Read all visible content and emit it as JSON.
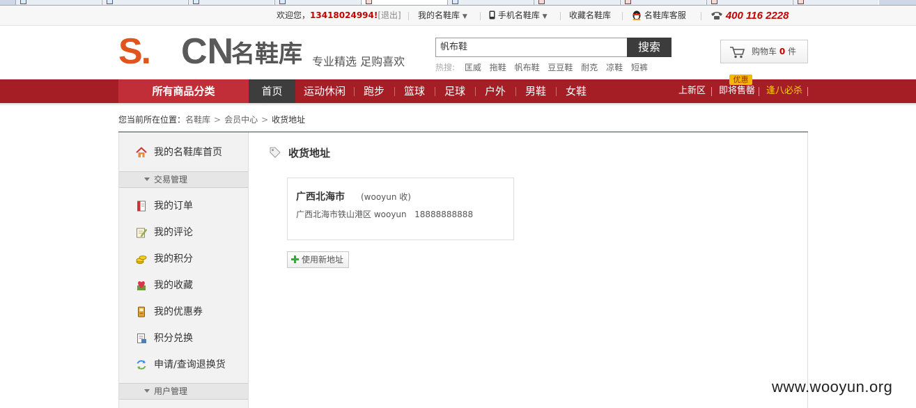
{
  "topbar": {
    "welcome": "欢迎您，",
    "user": "13418024994",
    "exclaim": "!",
    "logout": "[退出]",
    "my_account": "我的名鞋库",
    "mobile": "手机名鞋库",
    "favorite_site": "收藏名鞋库",
    "service": "名鞋库客服",
    "phone": "400 116 2228"
  },
  "header": {
    "logo_s": "S.",
    "logo_cn": "CN",
    "logo_name": "名鞋库",
    "slogan": "专业精选 足购喜欢",
    "search_value": "帆布鞋",
    "search_button": "搜索",
    "hot_label": "热搜:",
    "hot_keywords": [
      "匡威",
      "拖鞋",
      "帆布鞋",
      "豆豆鞋",
      "耐克",
      "凉鞋",
      "短裤"
    ],
    "cart_label": "购物车",
    "cart_count": "0",
    "cart_unit": "件"
  },
  "nav": {
    "all_categories": "所有商品分类",
    "items": [
      "首页",
      "运动休闲",
      "跑步",
      "篮球",
      "足球",
      "户外",
      "男鞋",
      "女鞋"
    ],
    "right": [
      "上新区",
      "即将售罄",
      "逢八必杀"
    ],
    "badge": "优惠"
  },
  "breadcrumb": {
    "prefix": "您当前所在位置：",
    "items": [
      "名鞋库",
      "会员中心",
      "收货地址"
    ]
  },
  "sidebar": {
    "home": "我的名鞋库首页",
    "section_trade": "交易管理",
    "items": [
      "我的订单",
      "我的评论",
      "我的积分",
      "我的收藏",
      "我的优惠券",
      "积分兑换",
      "申请/查询退换货"
    ],
    "section_user": "用户管理"
  },
  "content": {
    "title": "收货地址",
    "address": {
      "city": "广西北海市",
      "receiver": "(wooyun 收)",
      "detail": "广西北海市铁山港区 wooyun",
      "phone": "18888888888"
    },
    "new_address_button": "使用新地址"
  },
  "watermark": "www.wooyun.org",
  "colors": {
    "brand_red": "#a51d25",
    "accent_red": "#c40000",
    "orange": "#e0541d"
  }
}
